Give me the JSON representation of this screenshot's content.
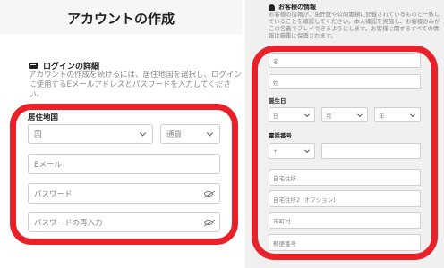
{
  "left": {
    "title": "アカウントの作成",
    "login_heading": "ログインの詳細",
    "login_description": "アカウントの作成を続けるには、居住地国を選択し、ログインに使用するEメールアドレスとパスワードを入力してください。",
    "residence_label": "居住地国",
    "country_placeholder": "国",
    "currency_placeholder": "通貨",
    "email_placeholder": "Eメール",
    "password_placeholder": "パスワード",
    "password_confirm_placeholder": "パスワードの再入力"
  },
  "right": {
    "heading": "お客様の情報",
    "description": "お客様の情報が、免許証や公的書類に記載されているものと一致していることを確認してください。本人確認を実施し、お客様のみがこの名義でプレイできるようにします。お客様に関するすべての情報は厳重に保護されます。",
    "first_name": "名",
    "last_name": "姓",
    "dob_label": "誕生日",
    "day": "日",
    "month": "月",
    "year": "年",
    "phone_label": "電話番号",
    "phone_code": "+",
    "address1": "自宅住所",
    "address2": "自宅住所2 (オプション)",
    "city": "市町村",
    "postal": "郵便番号"
  },
  "colors": {
    "highlight": "#e8222b"
  }
}
